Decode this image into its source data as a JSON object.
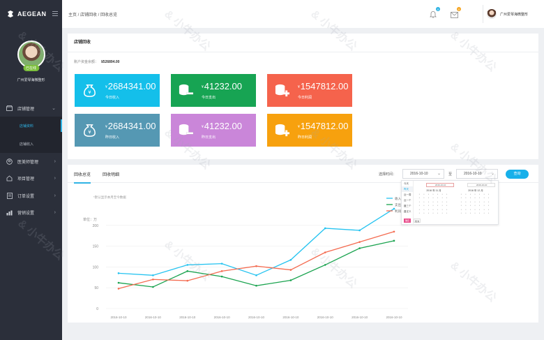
{
  "app": {
    "logo_text": "AEGEAN"
  },
  "profile": {
    "status": "已在线",
    "name": "广州爱琴海微整形"
  },
  "sidebar": {
    "items": [
      {
        "label": "店铺管理",
        "icon": "shop-icon"
      },
      {
        "label": "医美师管理",
        "icon": "doctor-icon"
      },
      {
        "label": "项目管理",
        "icon": "project-icon"
      },
      {
        "label": "订单设置",
        "icon": "order-icon"
      },
      {
        "label": "营销设置",
        "icon": "marketing-icon"
      }
    ],
    "subitems": [
      {
        "label": "店铺资料",
        "active": true
      },
      {
        "label": "店铺收入",
        "active": false
      }
    ]
  },
  "header": {
    "breadcrumb": "主页 / 店铺回收 / 回收总览",
    "bell_badge": "0",
    "mail_badge": "0",
    "user_name": "广州爱琴海微整形"
  },
  "stats": {
    "title": "店铺回收",
    "balance_label": "账户资金余额：",
    "balance_value": "¥526894.00",
    "cards": [
      {
        "currency": "¥",
        "value": "2684341.00",
        "label": "今日收入",
        "icon": "money-bag-icon",
        "color": "#14bfea"
      },
      {
        "currency": "¥",
        "value": "41232.00",
        "label": "今日支出",
        "icon": "coins-minus-icon",
        "color": "#17a453"
      },
      {
        "currency": "¥",
        "value": "1547812.00",
        "label": "今日利润",
        "icon": "coins-plus-icon",
        "color": "#f5634c"
      },
      {
        "currency": "¥",
        "value": "2684341.00",
        "label": "昨日收入",
        "icon": "money-bag-icon",
        "color": "#5598b3"
      },
      {
        "currency": "¥",
        "value": "41232.00",
        "label": "昨日支出",
        "icon": "coins-minus-icon",
        "color": "#ca86d9"
      },
      {
        "currency": "¥",
        "value": "1547812.00",
        "label": "昨日利润",
        "icon": "coins-plus-icon",
        "color": "#f7a10e"
      }
    ]
  },
  "analysis": {
    "tabs": [
      "回收总览",
      "回收明细"
    ],
    "filter_label": "选择时间：",
    "date_from": "2016-10-10",
    "to_label": "至",
    "date_to": "2016-10-10",
    "query_button": "查询",
    "note": "*默认显示本月至今数据",
    "unit": "单位：万"
  },
  "datepicker": {
    "side_options": [
      "今天",
      "昨天",
      "近一周",
      "近一个月",
      "近三个月",
      "自定义"
    ],
    "input_left": "2016-10-10",
    "input_right": "2016-10-10",
    "month_left": "2016 年 11 月",
    "month_right": "2016 年 12 月",
    "ok_label": "确定",
    "cancel_label": "取消"
  },
  "chart_data": {
    "type": "line",
    "categories": [
      "2016-10-10",
      "2016-10-10",
      "2016-10-10",
      "2016-10-10",
      "2016-10-10",
      "2016-10-10",
      "2016-10-10",
      "2016-10-10",
      "2016-10-10"
    ],
    "ylim": [
      0,
      250
    ],
    "yticks": [
      0,
      50,
      100,
      150,
      200
    ],
    "legend_position": "top-right",
    "series": [
      {
        "name": "收入",
        "color": "#25c3f0",
        "values": [
          85,
          80,
          105,
          108,
          80,
          117,
          193,
          188,
          240
        ]
      },
      {
        "name": "支出",
        "color": "#1aa34f",
        "values": [
          62,
          52,
          90,
          77,
          55,
          68,
          105,
          145,
          163
        ]
      },
      {
        "name": "利润",
        "color": "#f46b50",
        "values": [
          48,
          70,
          67,
          90,
          102,
          93,
          135,
          160,
          185
        ]
      }
    ]
  }
}
